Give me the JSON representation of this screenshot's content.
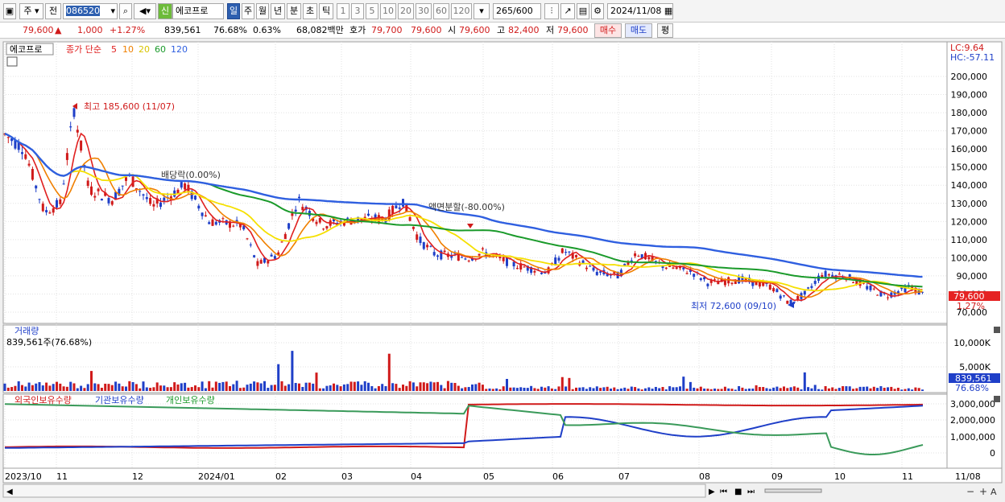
{
  "toolbar": {
    "market": "주",
    "period_prefix": "전",
    "code": "086520",
    "stock_name": "에코프로",
    "new_badge": "신",
    "periods": [
      "일",
      "주",
      "월",
      "년",
      "분",
      "초",
      "틱"
    ],
    "active_period": "일",
    "minute_values": [
      "1",
      "3",
      "5",
      "10",
      "20",
      "30",
      "60",
      "120"
    ],
    "count": "265",
    "count_total": "/600",
    "date": "2024/11/08"
  },
  "info": {
    "price": "79,600",
    "change_arrow": "▲",
    "change": "1,000",
    "change_pct": "+1.27%",
    "volume": "839,561",
    "volume_ratio": "76.68%",
    "turnover": "0.63%",
    "amount": "68,082백만",
    "quote_label": "호가",
    "ask": "79,700",
    "bid": "79,600",
    "open_label": "시",
    "open": "79,600",
    "high_label": "고",
    "high": "82,400",
    "low_label": "저",
    "low": "79,600",
    "buy_label": "매수",
    "sell_label": "매도",
    "avg_label": "평"
  },
  "price_panel": {
    "stock_tag": "에코프로",
    "ma_label": "종가 단순",
    "ma_periods": [
      "5",
      "10",
      "20",
      "60",
      "120"
    ],
    "lc": "LC:9.64",
    "hc": "HC:-57.11",
    "y_ticks": [
      "200,000",
      "190,000",
      "180,000",
      "170,000",
      "160,000",
      "150,000",
      "140,000",
      "130,000",
      "120,000",
      "110,000",
      "100,000",
      "90,000",
      "80,000",
      "70,000"
    ],
    "current_price_tag": "79,600",
    "current_pct_tag": "1.27%",
    "high_annotation": "최고 185,600 (11/07)",
    "low_annotation": "최저 72,600 (09/10)",
    "dividend_annotation": "배당락(0.00%)",
    "split_annotation": "액면분할(-80.00%)"
  },
  "volume_panel": {
    "title": "거래량",
    "value_label": "839,561주(76.68%)",
    "y_ticks": [
      "10,000K",
      "5,000K"
    ],
    "current_tag": "839,561",
    "current_pct_tag": "76.68%"
  },
  "holdings_panel": {
    "legend": [
      "외국인보유수량",
      "기관보유수량",
      "개인보유수량"
    ],
    "y_ticks": [
      "3,000,000",
      "2,000,000",
      "1,000,000",
      "0"
    ]
  },
  "x_axis": {
    "labels": [
      "2023/10",
      "11",
      "12",
      "2024/01",
      "02",
      "03",
      "04",
      "05",
      "06",
      "07",
      "08",
      "09",
      "10",
      "11"
    ],
    "right_label": "11/08"
  },
  "colors": {
    "up": "#d01a1a",
    "down": "#1f3fc8",
    "ma5": "#e02020",
    "ma10": "#f08000",
    "ma20": "#f5e000",
    "ma60": "#1a9a2a",
    "ma120": "#2f5fe0"
  }
}
